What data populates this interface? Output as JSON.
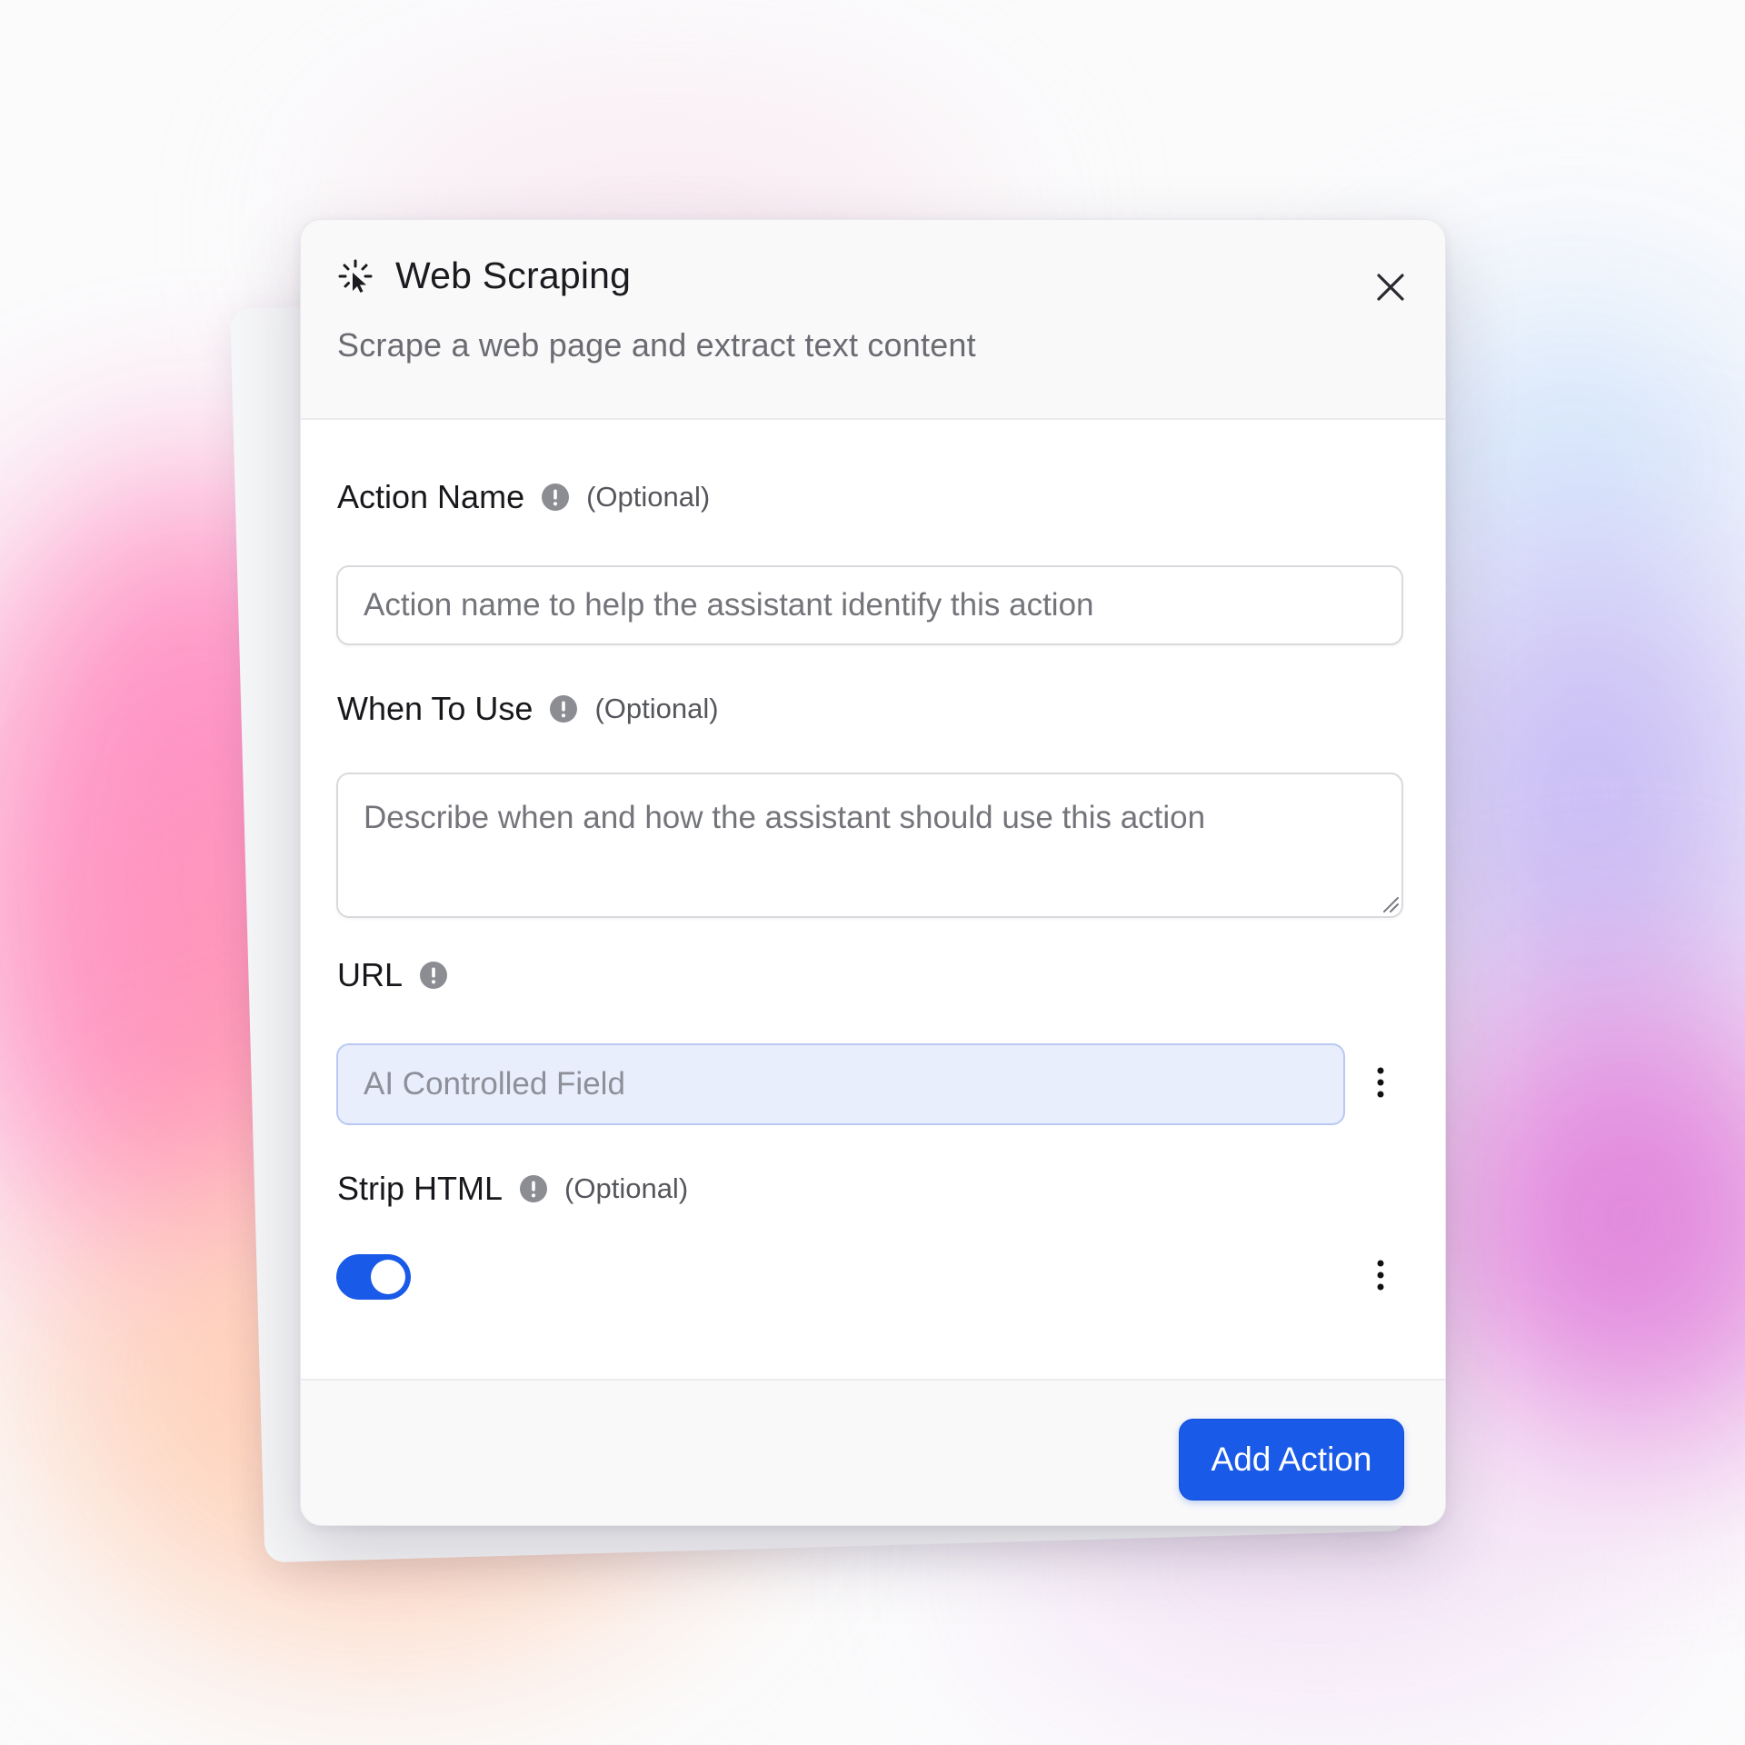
{
  "dialog": {
    "icon": "sparkle-cursor-icon",
    "title": "Web Scraping",
    "subtitle": "Scrape a web page and extract text content",
    "close_icon": "close-icon"
  },
  "fields": {
    "action_name": {
      "label": "Action Name",
      "optional": "(Optional)",
      "value": "",
      "placeholder": "Action name to help the assistant identify this action"
    },
    "when_to_use": {
      "label": "When To Use",
      "optional": "(Optional)",
      "value": "",
      "placeholder": "Describe when and how the assistant should use this action"
    },
    "url": {
      "label": "URL",
      "value": "",
      "placeholder": "AI Controlled Field"
    },
    "strip_html": {
      "label": "Strip HTML",
      "optional": "(Optional)",
      "enabled": true
    }
  },
  "footer": {
    "primary_label": "Add Action"
  },
  "colors": {
    "accent": "#1a5ae8",
    "ai_field_bg": "#e9eefd",
    "info_icon": "#8c8d93"
  }
}
